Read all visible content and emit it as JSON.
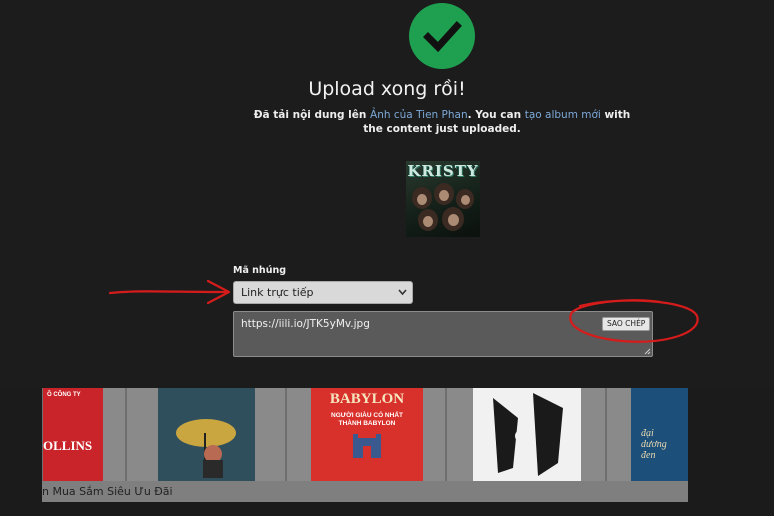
{
  "modal": {
    "title": "Upload xong rồi!",
    "message": {
      "part1": "Đã tải nội dung lên ",
      "link_album": "Ảnh của Tien Phan",
      "part2": ". You can ",
      "link_new_album": "tạo album mới",
      "part3": " with the content just uploaded."
    },
    "thumbnail_text": "KRISTY",
    "embed": {
      "label": "Mã nhúng",
      "selected_option": "Link trực tiếp",
      "code": "https://iili.io/JTK5yMv.jpg",
      "copy_label": "SAO CHÉP"
    }
  },
  "background_page": {
    "caption": "n Mua Sắm Siêu Ưu Đãi",
    "books": [
      {
        "cover_text": "Ô CÔNG TY",
        "cover_text2": "OLLINS"
      },
      {
        "cover_text": ""
      },
      {
        "cover_text": "BABYLON",
        "cover_text2": "NGƯỜI GIÀU CÓ NHẤT THÀNH BABYLON"
      },
      {
        "cover_text": ""
      },
      {
        "cover_text": "đại dương đen"
      }
    ]
  },
  "colors": {
    "success_green": "#1fa050",
    "annotation_red": "#d61b1b",
    "link_blue": "#7ca8d8"
  },
  "icons": {
    "success": "check-icon",
    "select": "chevron-down-icon"
  }
}
